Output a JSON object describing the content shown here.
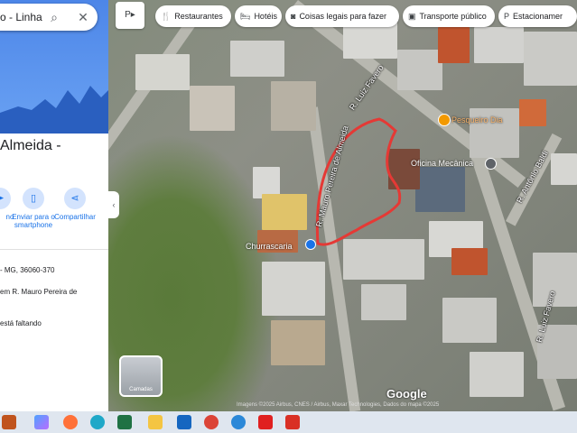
{
  "panel": {
    "search_text": "o - Linha",
    "place_title": "Almeida -",
    "actions": [
      {
        "label": "no"
      },
      {
        "label": "Enviar para o smartphone"
      },
      {
        "label": "Compartilhar"
      }
    ],
    "info_lines": [
      "- MG, 36060-370",
      "em R. Mauro Pereira de",
      "está faltando"
    ]
  },
  "filters": [
    {
      "label": "Restaurantes",
      "icon": "fork-knife-icon"
    },
    {
      "label": "Hotéis",
      "icon": "bed-icon"
    },
    {
      "label": "Coisas legais para fazer",
      "icon": "camera-icon"
    },
    {
      "label": "Transporte público",
      "icon": "bus-icon"
    },
    {
      "label": "Estacionamer",
      "icon": "parking-icon"
    }
  ],
  "streets": {
    "luiz_favero_top": "R. Luiz Favero",
    "mauro_pereira": "R. Mauro Pereira de Almeida",
    "antonio_baldi": "R. Antônio Baldi",
    "luiz_favero_bottom": "R. Luiz Favero"
  },
  "poi": {
    "restaurant": "Pesqueiro Dia",
    "oficina": "Oficina Mecânica",
    "churrascaria": "Churrascaria"
  },
  "layers_label": "Camadas",
  "google_logo": "Google",
  "attribution": "Imagens ©2025 Airbus, CNES / Airbus, Maxar Technologies, Dados do mapa ©2025",
  "colors": {
    "outline": "#e53935",
    "accent": "#1a73e8"
  }
}
